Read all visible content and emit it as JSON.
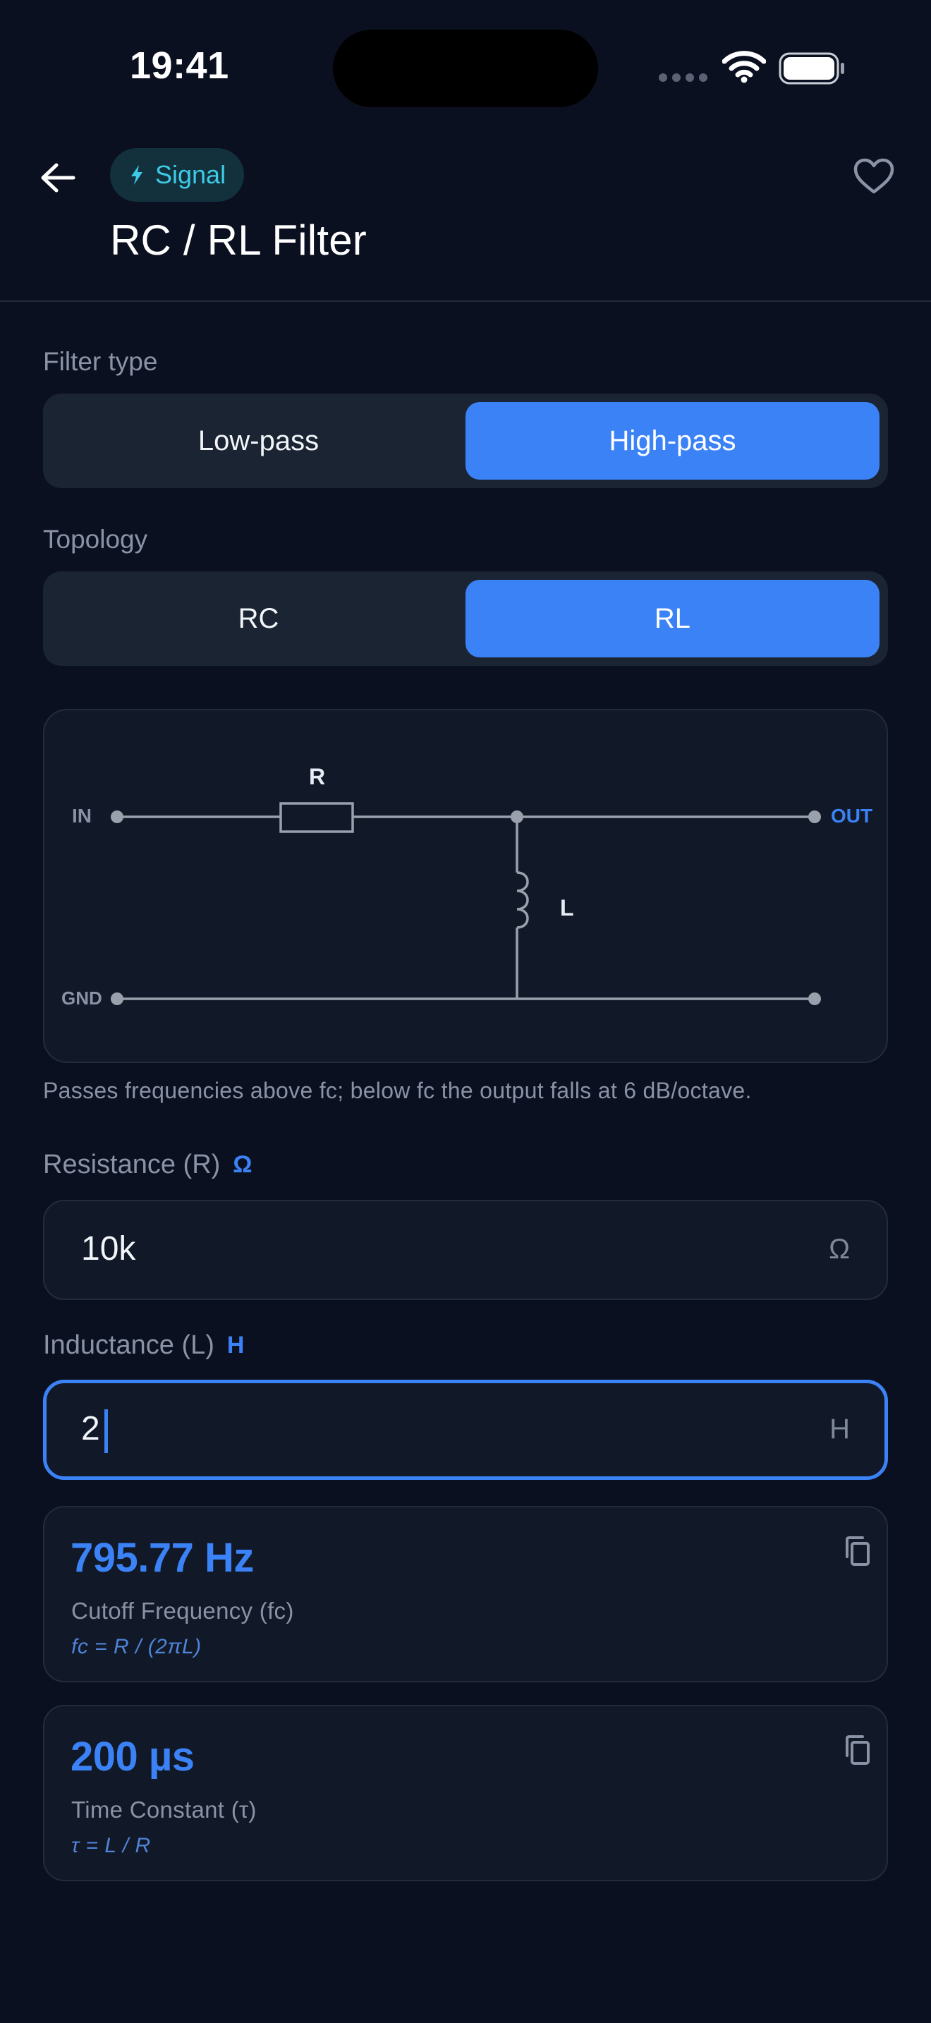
{
  "status_bar": {
    "time": "19:41"
  },
  "header": {
    "back_icon": "arrow-left-icon",
    "category_chip": {
      "icon": "bolt-icon",
      "label": "Signal"
    },
    "favorite_icon": "heart-outline-icon",
    "title": "RC / RL Filter"
  },
  "filter_type": {
    "label": "Filter type",
    "options": [
      "Low-pass",
      "High-pass"
    ],
    "selected": "High-pass"
  },
  "topology": {
    "label": "Topology",
    "options": [
      "RC",
      "RL"
    ],
    "selected": "RL"
  },
  "circuit": {
    "in_label": "IN",
    "out_label": "OUT",
    "gnd_label": "GND",
    "series_label": "R",
    "shunt_label": "L"
  },
  "description": "Passes frequencies above fc; below fc the output falls at 6 dB/octave.",
  "inputs": {
    "resistance": {
      "label": "Resistance (R)",
      "unit_tag": "Ω",
      "value": "10k",
      "unit": "Ω"
    },
    "inductance": {
      "label": "Inductance (L)",
      "unit_tag": "H",
      "value": "2",
      "unit": "H"
    }
  },
  "results": [
    {
      "value": "795.77 Hz",
      "name": "Cutoff Frequency (fc)",
      "formula": "fc = R / (2πL)",
      "icon": "copy-icon"
    },
    {
      "value": "200 µs",
      "name": "Time Constant (τ)",
      "formula": "τ = L / R",
      "icon": "copy-icon"
    }
  ],
  "colors": {
    "background": "#0b1020",
    "accent": "#3b82f6",
    "chip_text": "#3ecbe6",
    "muted_text": "#8a93a6"
  }
}
